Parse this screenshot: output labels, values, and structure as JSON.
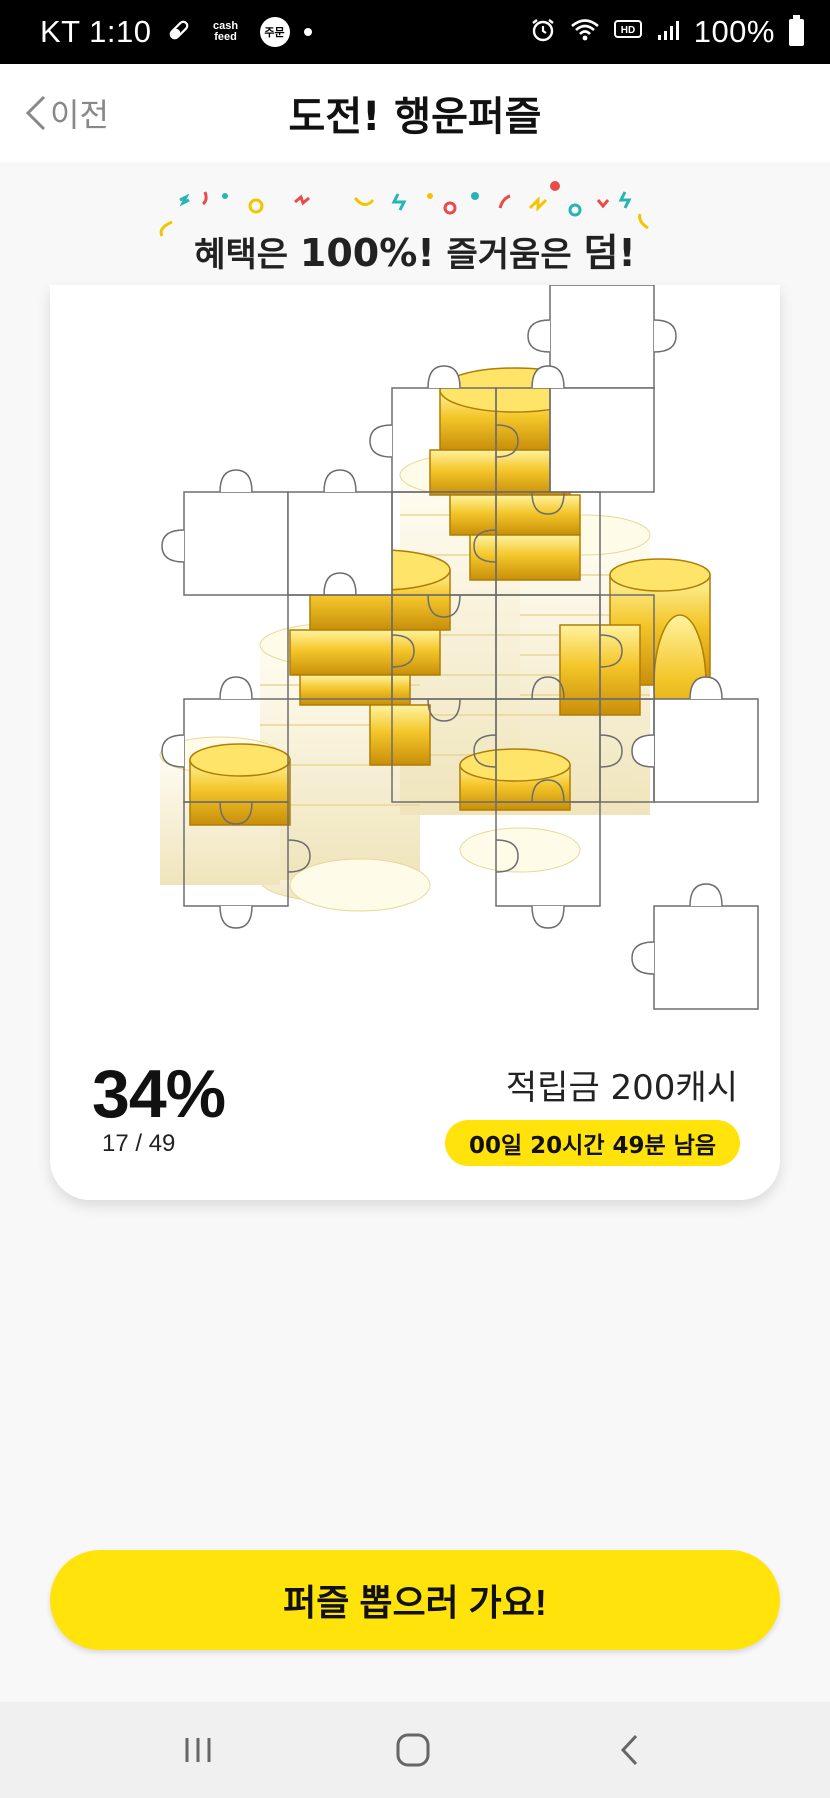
{
  "status_bar": {
    "carrier_time": "KT 1:10",
    "cashfeed_text": "cash feed",
    "order_badge": "주문",
    "battery_percent": "100%",
    "icons": [
      "pill-icon",
      "cashfeed-icon",
      "order-badge-icon",
      "notification-dot",
      "alarm-icon",
      "wifi-icon",
      "hd-voice-icon",
      "signal-icon",
      "battery-icon"
    ]
  },
  "header": {
    "back_label": "이전",
    "title": "도전! 행운퍼즐"
  },
  "banner": {
    "text_a": "혜택은 ",
    "text_b": "100%!",
    "text_c": " 즐거움은 ",
    "text_d": "덤!"
  },
  "puzzle": {
    "image_description_icon": "gold-coins-image",
    "progress_percent": "34%",
    "progress_count": "17 / 49",
    "progress_fraction": 0.34
  },
  "reward": {
    "label": "적립금 200캐시",
    "time_left": "00일 20시간 49분 남음"
  },
  "cta": {
    "label": "퍼즐 뽑으러 가요!"
  },
  "nav": {
    "icons": [
      "recent-apps-icon",
      "home-icon",
      "back-icon"
    ]
  },
  "colors": {
    "accent_yellow": "#ffe30a",
    "status_bar": "#000000",
    "background": "#f8f8f8"
  }
}
